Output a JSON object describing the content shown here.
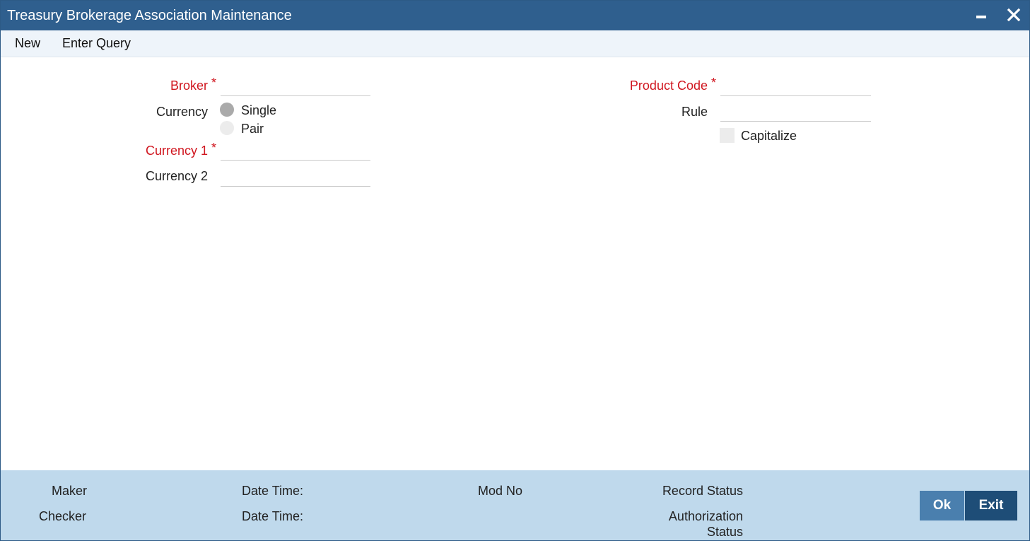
{
  "window": {
    "title": "Treasury Brokerage Association Maintenance"
  },
  "icons": {
    "minimize": "minimize-icon",
    "close": "close-icon"
  },
  "toolbar": {
    "new_label": "New",
    "enter_query_label": "Enter Query"
  },
  "form": {
    "broker": {
      "label": "Broker",
      "required_mark": "*",
      "value": ""
    },
    "currency": {
      "label": "Currency",
      "options": [
        {
          "label": "Single",
          "selected": true
        },
        {
          "label": "Pair",
          "selected": false
        }
      ]
    },
    "currency1": {
      "label": "Currency 1",
      "required_mark": "*",
      "value": ""
    },
    "currency2": {
      "label": "Currency 2",
      "value": ""
    },
    "product_code": {
      "label": "Product Code",
      "required_mark": "*",
      "value": ""
    },
    "rule": {
      "label": "Rule",
      "value": ""
    },
    "capitalize": {
      "label": "Capitalize",
      "checked": false
    }
  },
  "footer": {
    "maker_label": "Maker",
    "checker_label": "Checker",
    "date_time_label_1": "Date Time:",
    "date_time_label_2": "Date Time:",
    "mod_no_label": "Mod No",
    "record_status_label": "Record Status",
    "authorization_label_line1": "Authorization",
    "authorization_label_line2": "Status",
    "ok_label": "Ok",
    "exit_label": "Exit"
  },
  "colors": {
    "title_bar": "#2f5f8e",
    "required": "#d0161f",
    "footer_bg": "#bfd9ec",
    "ok_button": "#4a7fae",
    "exit_button": "#1e4d77"
  }
}
